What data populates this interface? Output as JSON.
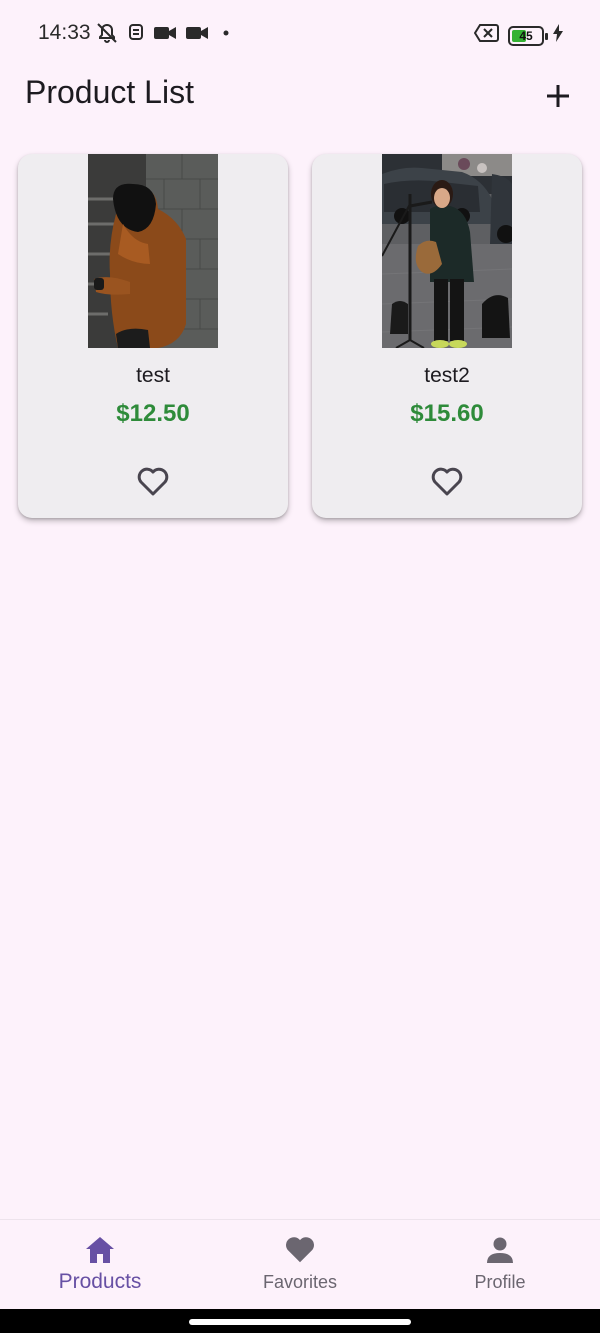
{
  "status_bar": {
    "time": "14:33",
    "battery_level": "45",
    "icons_left": [
      "mute-icon",
      "notification-icon",
      "video-icon",
      "video-icon",
      "dot-icon"
    ],
    "icons_right": [
      "no-sim-icon",
      "battery-icon",
      "charging-icon"
    ]
  },
  "app_bar": {
    "title": "Product List",
    "action_icon": "plus-icon"
  },
  "products": [
    {
      "name": "test",
      "price": "$12.50",
      "image": "photo of person in orange hooded jacket leaning on wall",
      "favorite_icon": "heart-outline-icon"
    },
    {
      "name": "test2",
      "price": "$15.60",
      "image": "photo of woman singing into microphone with guitar on street",
      "favorite_icon": "heart-outline-icon"
    }
  ],
  "bottom_nav": {
    "items": [
      {
        "label": "Products",
        "icon": "home-icon",
        "active": true
      },
      {
        "label": "Favorites",
        "icon": "heart-filled-icon",
        "active": false
      },
      {
        "label": "Profile",
        "icon": "person-icon",
        "active": false
      }
    ]
  },
  "colors": {
    "background": "#fdf2fb",
    "card": "#efedf0",
    "price": "#2e8b3a",
    "accent": "#6750a4",
    "inactive": "#6b6670"
  }
}
